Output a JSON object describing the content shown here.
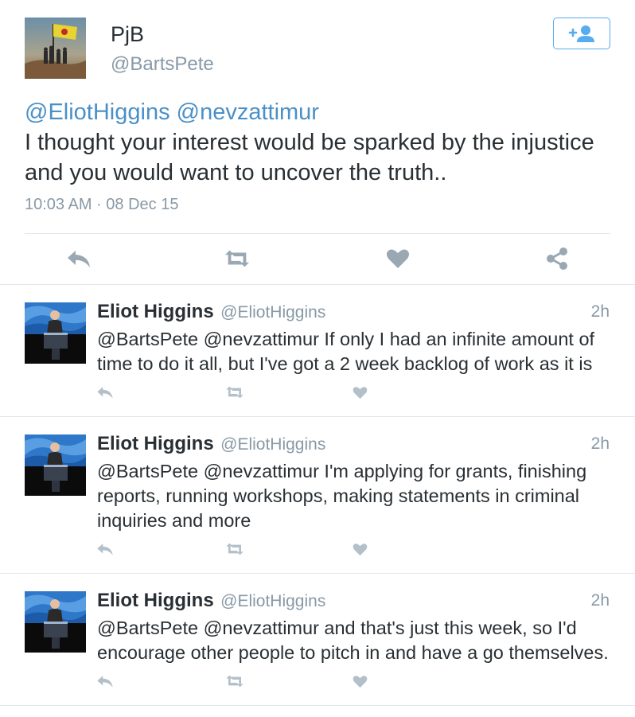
{
  "main_tweet": {
    "name": "PjB",
    "handle": "@BartsPete",
    "mention_1": "@EliotHiggins",
    "mention_2": "@nevzattimur",
    "text": "I thought your interest would be sparked by the injustice and you would want to uncover the truth..",
    "timestamp": "10:03 AM · 08 Dec 15",
    "follow_icon": "add-user-icon"
  },
  "replies": [
    {
      "name": "Eliot Higgins",
      "handle": "@EliotHiggins",
      "time": "2h",
      "text": "@BartsPete @nevzattimur If only I had an infinite amount of time to do it all, but I've got a 2 week backlog of work as it is"
    },
    {
      "name": "Eliot Higgins",
      "handle": "@EliotHiggins",
      "time": "2h",
      "text": "@BartsPete @nevzattimur I'm applying for grants, finishing reports, running workshops, making statements in criminal inquiries and more"
    },
    {
      "name": "Eliot Higgins",
      "handle": "@EliotHiggins",
      "time": "2h",
      "text": "@BartsPete @nevzattimur and that's just this week, so I'd encourage other people to pitch in and have a go themselves."
    }
  ],
  "colors": {
    "link": "#4a90c8",
    "icon_main": "#9aa8b3",
    "icon_reply": "#b4c0c9",
    "follow_blue": "#55acee"
  }
}
